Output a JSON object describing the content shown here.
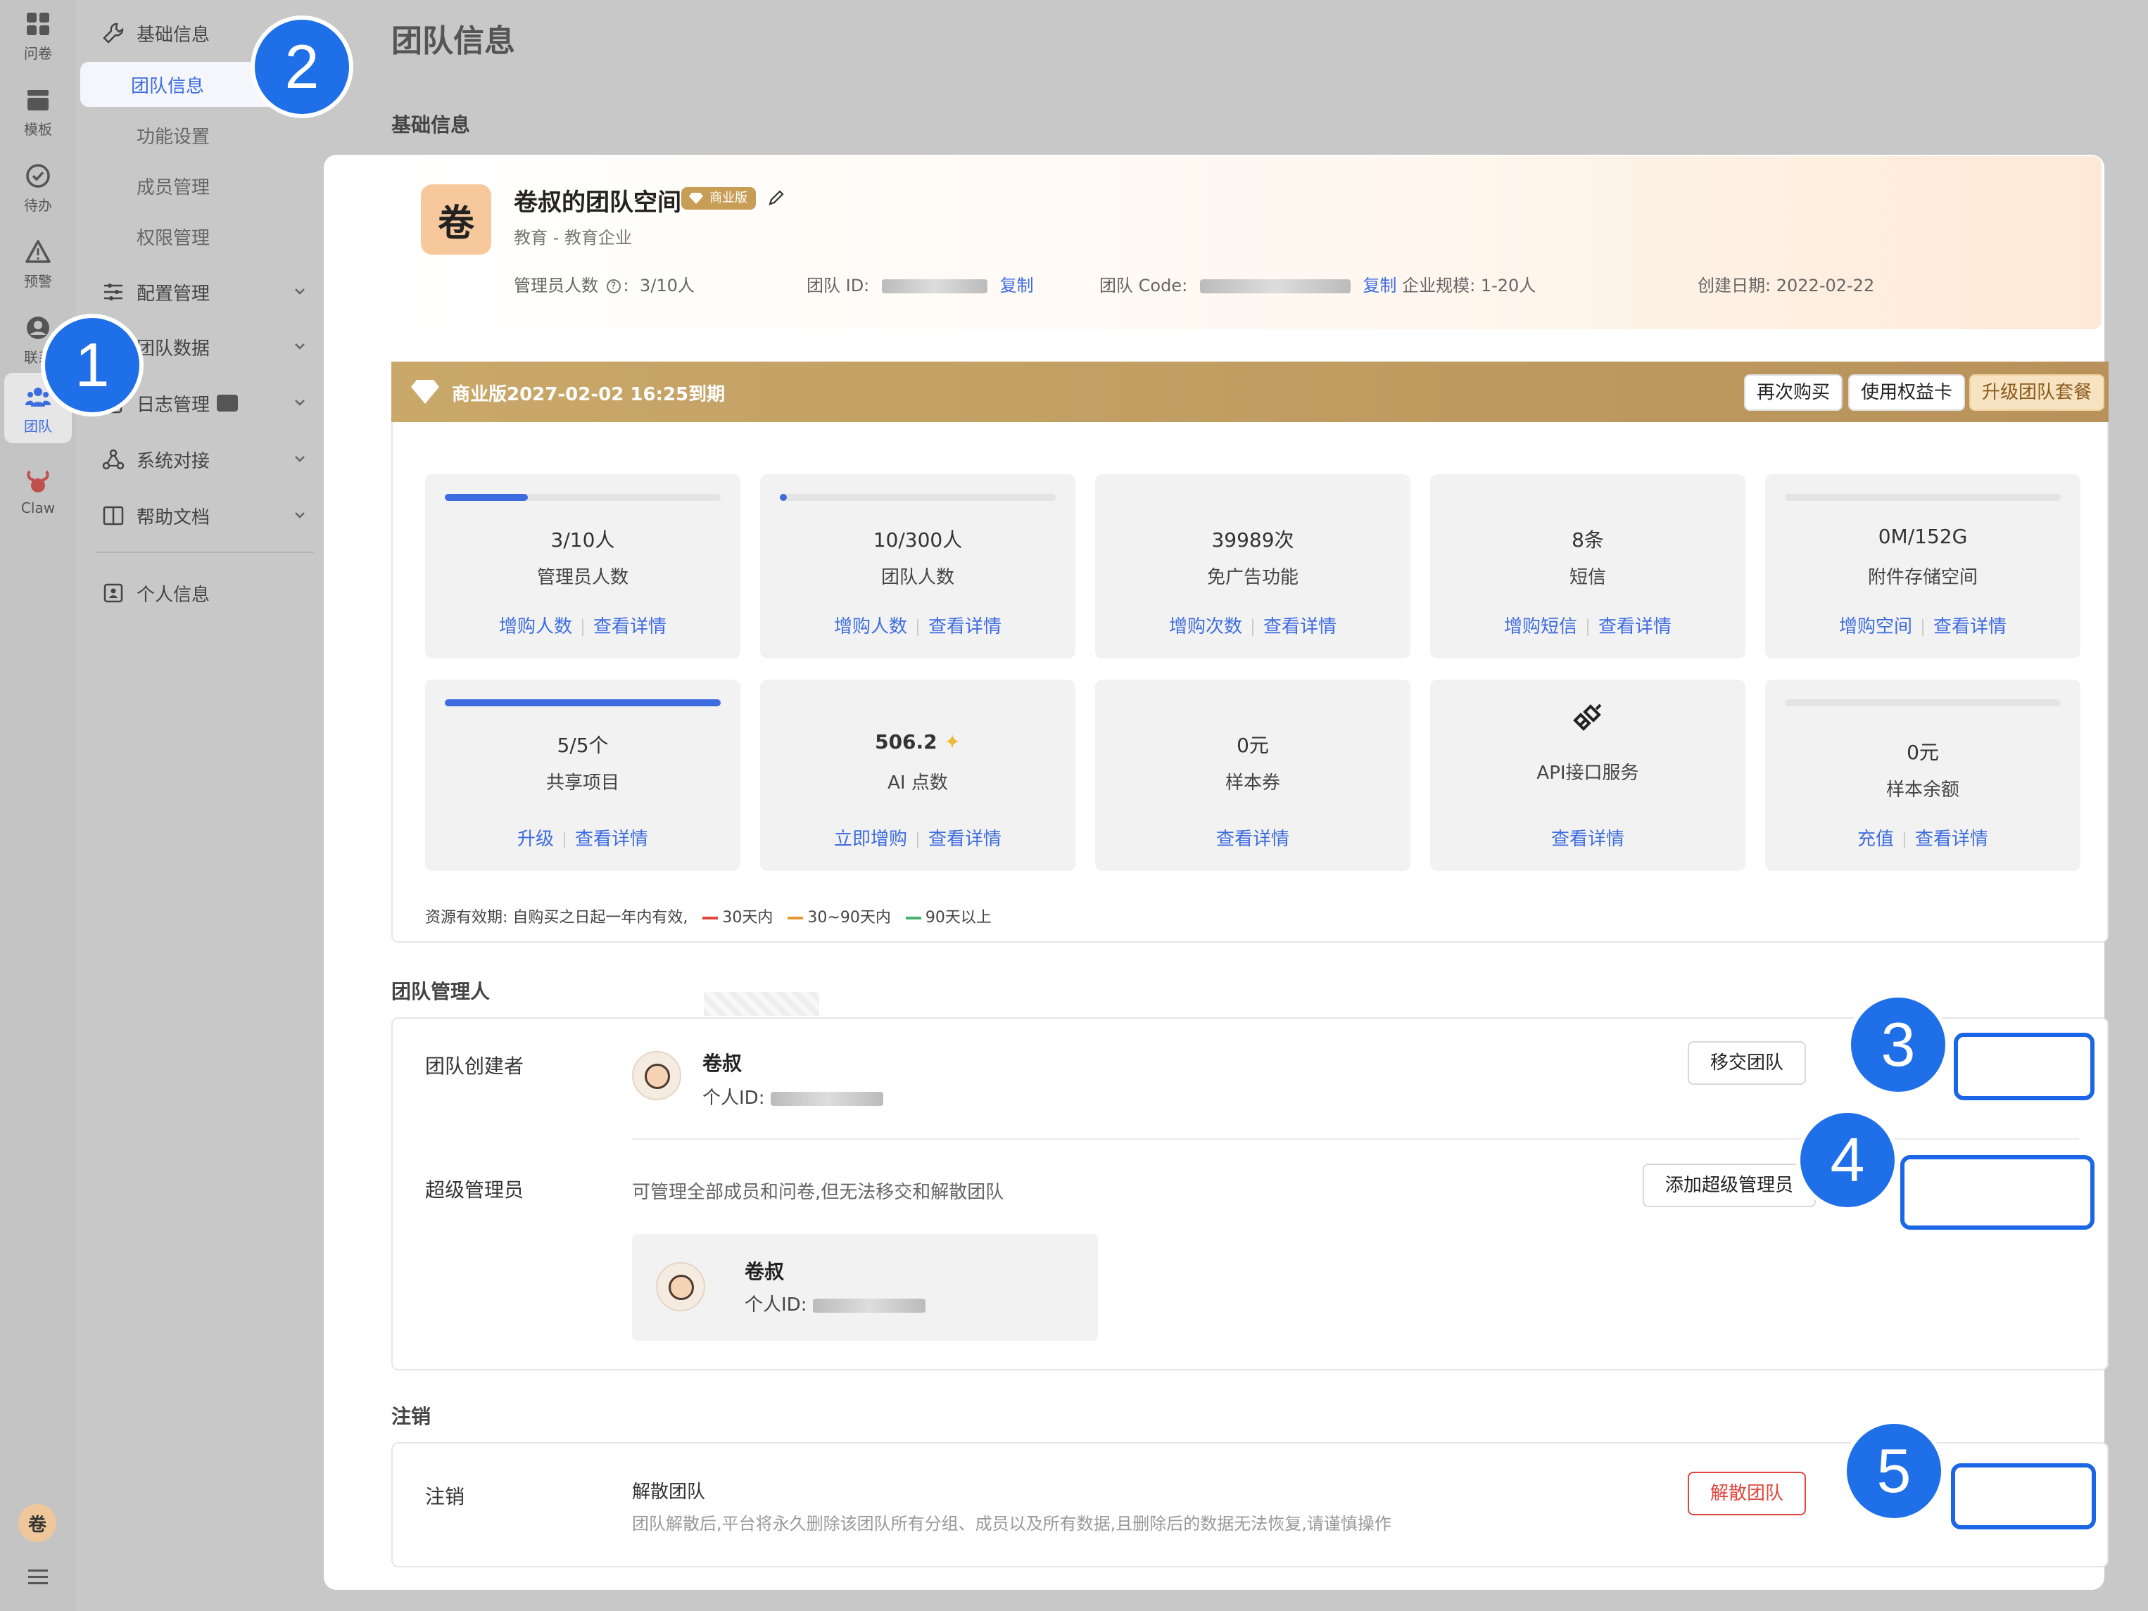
{
  "rail": {
    "items": [
      {
        "label": "问卷",
        "icon": "grid-icon"
      },
      {
        "label": "模板",
        "icon": "template-icon"
      },
      {
        "label": "待办",
        "icon": "check-circle-icon"
      },
      {
        "label": "预警",
        "icon": "warning-icon"
      },
      {
        "label": "联系",
        "icon": "contact-icon"
      },
      {
        "label": "团队",
        "icon": "team-icon"
      },
      {
        "label": "Claw",
        "icon": "claw-icon"
      }
    ],
    "user_avatar": "卷",
    "menu_icon": "hamburger-icon"
  },
  "sidebar": {
    "base_info": "基础信息",
    "team_info": "团队信息",
    "feature_settings": "功能设置",
    "member_mgmt": "成员管理",
    "permission_mgmt": "权限管理",
    "config_mgmt": "配置管理",
    "team_data": "团队数据",
    "log_mgmt": "日志管理",
    "system_integration": "系统对接",
    "help_docs": "帮助文档",
    "personal_info": "个人信息"
  },
  "page": {
    "title": "团队信息",
    "basic_section": "基础信息"
  },
  "team": {
    "logo": "卷",
    "name": "卷叔的团队空间",
    "edition_badge": "商业版",
    "type": "教育 - 教育企业",
    "admin_count_label": "管理员人数",
    "admin_count": "3/10人",
    "id_label": "团队 ID:",
    "copy": "复制",
    "code_label": "团队 Code:",
    "scale_label": "企业规模:",
    "scale": "1-20人",
    "created_label": "创建日期:",
    "created": "2022-02-22"
  },
  "plan": {
    "text": "商业版2027-02-02 16:25到期",
    "buy_again": "再次购买",
    "use_card": "使用权益卡",
    "upgrade": "升级团队套餐"
  },
  "resources": [
    {
      "value": "3/10人",
      "name": "管理员人数",
      "progress": 0.3,
      "actions": [
        "增购人数",
        "查看详情"
      ]
    },
    {
      "value": "10/300人",
      "name": "团队人数",
      "progress": 0.033,
      "actions": [
        "增购人数",
        "查看详情"
      ]
    },
    {
      "value": "39989次",
      "name": "免广告功能",
      "progress": null,
      "actions": [
        "增购次数",
        "查看详情"
      ]
    },
    {
      "value": "8条",
      "name": "短信",
      "progress": null,
      "actions": [
        "增购短信",
        "查看详情"
      ]
    },
    {
      "value": "0M/152G",
      "name": "附件存储空间",
      "progress": 0,
      "actions": [
        "增购空间",
        "查看详情"
      ]
    },
    {
      "value": "5/5个",
      "name": "共享项目",
      "progress": 1.0,
      "actions": [
        "升级",
        "查看详情"
      ]
    },
    {
      "value": "506.2",
      "name": "AI 点数",
      "progress": null,
      "actions": [
        "立即增购",
        "查看详情"
      ]
    },
    {
      "value": "0元",
      "name": "样本券",
      "progress": null,
      "actions": [
        "查看详情"
      ]
    },
    {
      "value": "",
      "name": "API接口服务",
      "progress": null,
      "actions": [
        "查看详情"
      ]
    },
    {
      "value": "0元",
      "name": "样本余额",
      "progress": 0,
      "actions": [
        "充值",
        "查看详情"
      ]
    }
  ],
  "legend": {
    "prefix": "资源有效期: 自购买之日起一年内有效,",
    "red": "30天内",
    "orange": "30~90天内",
    "green": "90天以上",
    "colors": {
      "red": "#e0463b",
      "orange": "#e8982e",
      "green": "#46b36c"
    }
  },
  "managers": {
    "section": "团队管理人",
    "creator_label": "团队创建者",
    "creator_name": "卷叔",
    "uid_label": "个人ID:",
    "transfer_btn": "移交团队",
    "super_label": "超级管理员",
    "super_desc": "可管理全部成员和问卷,但无法移交和解散团队",
    "add_super_btn": "添加超级管理员",
    "super_name": "卷叔"
  },
  "cancel": {
    "section": "注销",
    "label": "注销",
    "title": "解散团队",
    "desc": "团队解散后,平台将永久删除该团队所有分组、成员以及所有数据,且删除后的数据无法恢复,请谨慎操作",
    "dissolve_btn": "解散团队"
  },
  "callouts": [
    "1",
    "2",
    "3",
    "4",
    "5"
  ],
  "colors": {
    "accent": "#3d6ce0",
    "callout": "#1f6fe8",
    "gold": "#c89d55",
    "danger": "#e0463b"
  }
}
